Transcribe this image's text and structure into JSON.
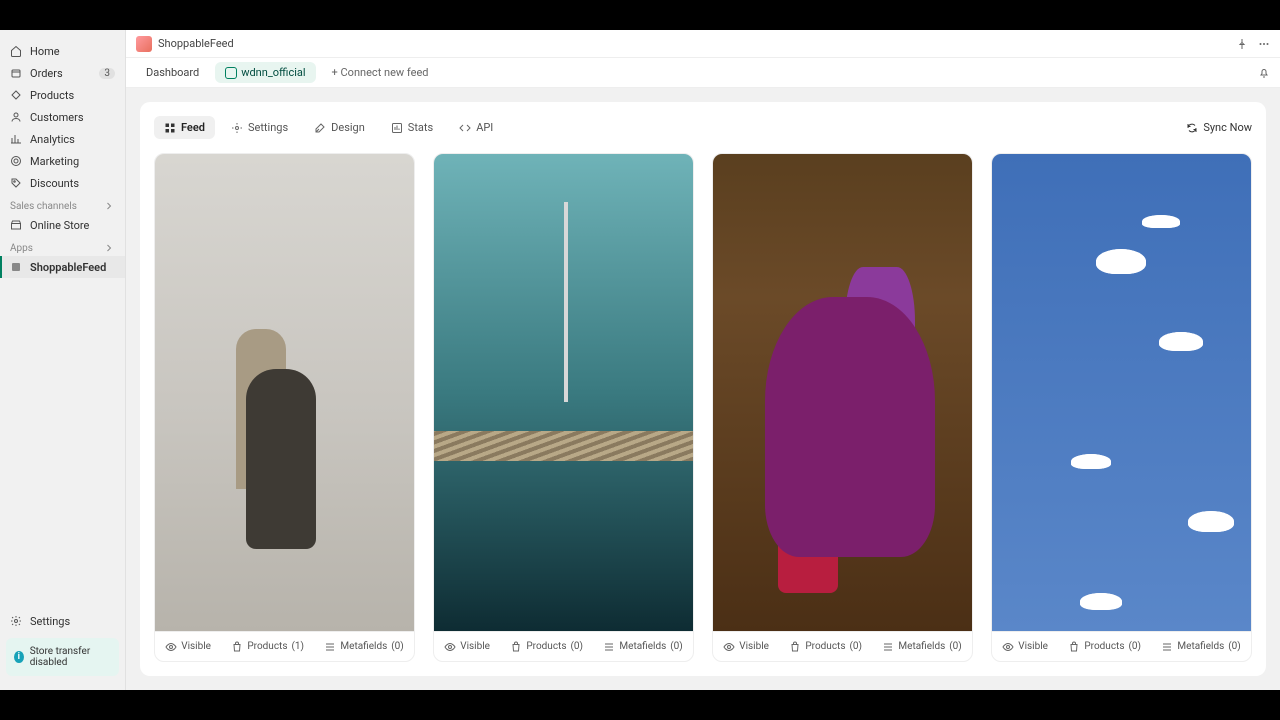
{
  "app": {
    "title": "ShoppableFeed"
  },
  "sidebar": {
    "items": [
      {
        "label": "Home"
      },
      {
        "label": "Orders",
        "badge": "3"
      },
      {
        "label": "Products"
      },
      {
        "label": "Customers"
      },
      {
        "label": "Analytics"
      },
      {
        "label": "Marketing"
      },
      {
        "label": "Discounts"
      }
    ],
    "sales_channels_label": "Sales channels",
    "online_store": "Online Store",
    "apps_label": "Apps",
    "shoppable": "ShoppableFeed",
    "settings": "Settings",
    "store_transfer": "Store transfer disabled"
  },
  "tabs": {
    "dashboard": "Dashboard",
    "feed_name": "wdnn_official",
    "connect": "+ Connect new feed"
  },
  "subtabs": {
    "feed": "Feed",
    "settings": "Settings",
    "design": "Design",
    "stats": "Stats",
    "api": "API",
    "sync": "Sync Now"
  },
  "card_footer": {
    "visible": "Visible",
    "products": "Products",
    "metafields": "Metafields"
  },
  "cards": [
    {
      "products": "(1)",
      "metafields": "(0)"
    },
    {
      "products": "(0)",
      "metafields": "(0)"
    },
    {
      "products": "(0)",
      "metafields": "(0)"
    },
    {
      "products": "(0)",
      "metafields": "(0)"
    }
  ]
}
